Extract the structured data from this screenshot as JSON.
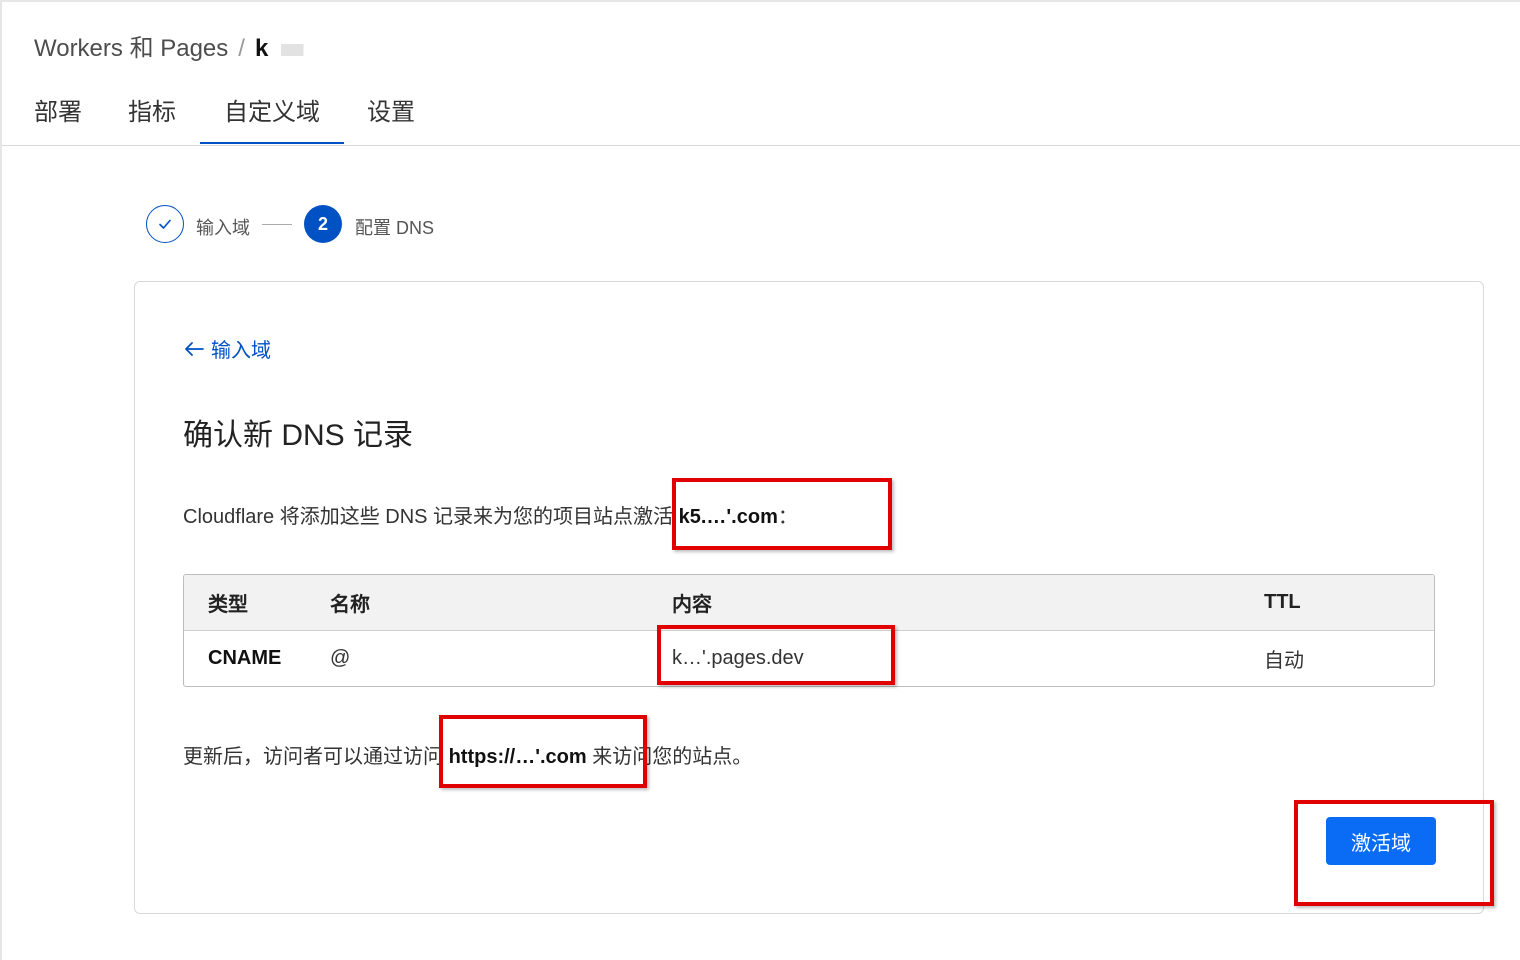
{
  "breadcrumb": {
    "root": "Workers 和 Pages",
    "separator": "/",
    "current": "k"
  },
  "tabs": [
    {
      "label": "部署",
      "active": false
    },
    {
      "label": "指标",
      "active": false
    },
    {
      "label": "自定义域",
      "active": true
    },
    {
      "label": "设置",
      "active": false
    }
  ],
  "stepper": {
    "steps": [
      {
        "label": "输入域",
        "status": "done"
      },
      {
        "label": "配置 DNS",
        "number": "2",
        "status": "active"
      }
    ]
  },
  "card": {
    "back_link": "输入域",
    "title": "确认新 DNS 记录",
    "description_prefix": "Cloudflare 将添加这些 DNS 记录来为您的项目站点激活 ",
    "description_domain": "k5.…'.com",
    "description_suffix": "：",
    "table": {
      "headers": [
        "类型",
        "名称",
        "内容",
        "TTL"
      ],
      "rows": [
        {
          "type": "CNAME",
          "name": "@",
          "content": "k…'.pages.dev",
          "ttl": "自动"
        }
      ]
    },
    "after_prefix": "更新后，访问者可以通过访问 ",
    "after_url": "https://…'.com",
    "after_suffix": " 来访问您的站点。",
    "activate_button": "激活域"
  },
  "colors": {
    "accent": "#0051c3",
    "button": "#0a6cf5",
    "highlight": "#e00000"
  }
}
